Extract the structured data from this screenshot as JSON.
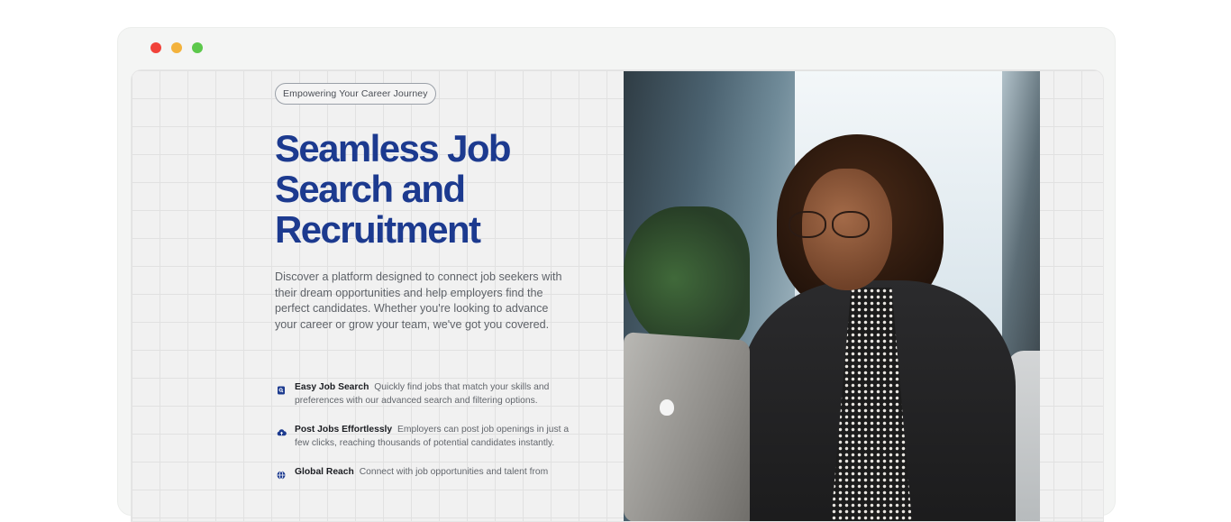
{
  "window": {
    "controls": [
      "close",
      "minimize",
      "maximize"
    ]
  },
  "hero": {
    "tag": "Empowering Your Career Journey",
    "title": "Seamless Job Search and Recruitment",
    "description": "Discover a platform designed to connect job seekers with their dream opportunities and help employers find the perfect candidates. Whether you're looking to advance your career or grow your team, we've got you covered.",
    "image_alt": "Woman with curly hair and glasses working on a laptop"
  },
  "features": [
    {
      "icon": "search-doc-icon",
      "title": "Easy Job Search",
      "text": "Quickly find jobs that match your skills and preferences with our advanced search and filtering options."
    },
    {
      "icon": "cloud-upload-icon",
      "title": "Post Jobs Effortlessly",
      "text": "Employers can post job openings in just a few clicks, reaching thousands of potential candidates instantly."
    },
    {
      "icon": "globe-icon",
      "title": "Global Reach",
      "text": "Connect with job opportunities and talent from"
    }
  ],
  "colors": {
    "title": "#1c3a8f",
    "icon": "#1c3a8f",
    "close": "#f1423a",
    "minimize": "#f3b23c",
    "maximize": "#5cc84b"
  }
}
